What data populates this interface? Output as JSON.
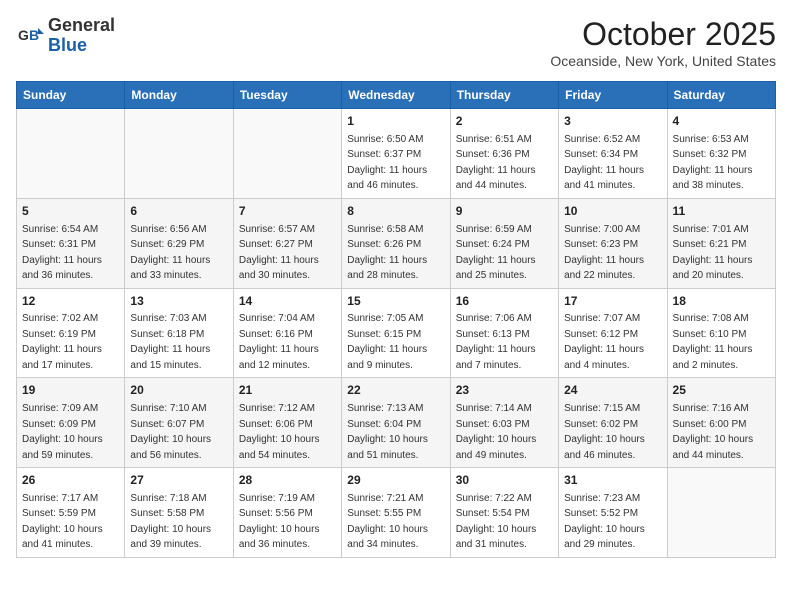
{
  "header": {
    "logo_general": "General",
    "logo_blue": "Blue",
    "title": "October 2025",
    "subtitle": "Oceanside, New York, United States"
  },
  "columns": [
    "Sunday",
    "Monday",
    "Tuesday",
    "Wednesday",
    "Thursday",
    "Friday",
    "Saturday"
  ],
  "weeks": [
    [
      {
        "day": "",
        "sunrise": "",
        "sunset": "",
        "daylight": ""
      },
      {
        "day": "",
        "sunrise": "",
        "sunset": "",
        "daylight": ""
      },
      {
        "day": "",
        "sunrise": "",
        "sunset": "",
        "daylight": ""
      },
      {
        "day": "1",
        "sunrise": "Sunrise: 6:50 AM",
        "sunset": "Sunset: 6:37 PM",
        "daylight": "Daylight: 11 hours and 46 minutes."
      },
      {
        "day": "2",
        "sunrise": "Sunrise: 6:51 AM",
        "sunset": "Sunset: 6:36 PM",
        "daylight": "Daylight: 11 hours and 44 minutes."
      },
      {
        "day": "3",
        "sunrise": "Sunrise: 6:52 AM",
        "sunset": "Sunset: 6:34 PM",
        "daylight": "Daylight: 11 hours and 41 minutes."
      },
      {
        "day": "4",
        "sunrise": "Sunrise: 6:53 AM",
        "sunset": "Sunset: 6:32 PM",
        "daylight": "Daylight: 11 hours and 38 minutes."
      }
    ],
    [
      {
        "day": "5",
        "sunrise": "Sunrise: 6:54 AM",
        "sunset": "Sunset: 6:31 PM",
        "daylight": "Daylight: 11 hours and 36 minutes."
      },
      {
        "day": "6",
        "sunrise": "Sunrise: 6:56 AM",
        "sunset": "Sunset: 6:29 PM",
        "daylight": "Daylight: 11 hours and 33 minutes."
      },
      {
        "day": "7",
        "sunrise": "Sunrise: 6:57 AM",
        "sunset": "Sunset: 6:27 PM",
        "daylight": "Daylight: 11 hours and 30 minutes."
      },
      {
        "day": "8",
        "sunrise": "Sunrise: 6:58 AM",
        "sunset": "Sunset: 6:26 PM",
        "daylight": "Daylight: 11 hours and 28 minutes."
      },
      {
        "day": "9",
        "sunrise": "Sunrise: 6:59 AM",
        "sunset": "Sunset: 6:24 PM",
        "daylight": "Daylight: 11 hours and 25 minutes."
      },
      {
        "day": "10",
        "sunrise": "Sunrise: 7:00 AM",
        "sunset": "Sunset: 6:23 PM",
        "daylight": "Daylight: 11 hours and 22 minutes."
      },
      {
        "day": "11",
        "sunrise": "Sunrise: 7:01 AM",
        "sunset": "Sunset: 6:21 PM",
        "daylight": "Daylight: 11 hours and 20 minutes."
      }
    ],
    [
      {
        "day": "12",
        "sunrise": "Sunrise: 7:02 AM",
        "sunset": "Sunset: 6:19 PM",
        "daylight": "Daylight: 11 hours and 17 minutes."
      },
      {
        "day": "13",
        "sunrise": "Sunrise: 7:03 AM",
        "sunset": "Sunset: 6:18 PM",
        "daylight": "Daylight: 11 hours and 15 minutes."
      },
      {
        "day": "14",
        "sunrise": "Sunrise: 7:04 AM",
        "sunset": "Sunset: 6:16 PM",
        "daylight": "Daylight: 11 hours and 12 minutes."
      },
      {
        "day": "15",
        "sunrise": "Sunrise: 7:05 AM",
        "sunset": "Sunset: 6:15 PM",
        "daylight": "Daylight: 11 hours and 9 minutes."
      },
      {
        "day": "16",
        "sunrise": "Sunrise: 7:06 AM",
        "sunset": "Sunset: 6:13 PM",
        "daylight": "Daylight: 11 hours and 7 minutes."
      },
      {
        "day": "17",
        "sunrise": "Sunrise: 7:07 AM",
        "sunset": "Sunset: 6:12 PM",
        "daylight": "Daylight: 11 hours and 4 minutes."
      },
      {
        "day": "18",
        "sunrise": "Sunrise: 7:08 AM",
        "sunset": "Sunset: 6:10 PM",
        "daylight": "Daylight: 11 hours and 2 minutes."
      }
    ],
    [
      {
        "day": "19",
        "sunrise": "Sunrise: 7:09 AM",
        "sunset": "Sunset: 6:09 PM",
        "daylight": "Daylight: 10 hours and 59 minutes."
      },
      {
        "day": "20",
        "sunrise": "Sunrise: 7:10 AM",
        "sunset": "Sunset: 6:07 PM",
        "daylight": "Daylight: 10 hours and 56 minutes."
      },
      {
        "day": "21",
        "sunrise": "Sunrise: 7:12 AM",
        "sunset": "Sunset: 6:06 PM",
        "daylight": "Daylight: 10 hours and 54 minutes."
      },
      {
        "day": "22",
        "sunrise": "Sunrise: 7:13 AM",
        "sunset": "Sunset: 6:04 PM",
        "daylight": "Daylight: 10 hours and 51 minutes."
      },
      {
        "day": "23",
        "sunrise": "Sunrise: 7:14 AM",
        "sunset": "Sunset: 6:03 PM",
        "daylight": "Daylight: 10 hours and 49 minutes."
      },
      {
        "day": "24",
        "sunrise": "Sunrise: 7:15 AM",
        "sunset": "Sunset: 6:02 PM",
        "daylight": "Daylight: 10 hours and 46 minutes."
      },
      {
        "day": "25",
        "sunrise": "Sunrise: 7:16 AM",
        "sunset": "Sunset: 6:00 PM",
        "daylight": "Daylight: 10 hours and 44 minutes."
      }
    ],
    [
      {
        "day": "26",
        "sunrise": "Sunrise: 7:17 AM",
        "sunset": "Sunset: 5:59 PM",
        "daylight": "Daylight: 10 hours and 41 minutes."
      },
      {
        "day": "27",
        "sunrise": "Sunrise: 7:18 AM",
        "sunset": "Sunset: 5:58 PM",
        "daylight": "Daylight: 10 hours and 39 minutes."
      },
      {
        "day": "28",
        "sunrise": "Sunrise: 7:19 AM",
        "sunset": "Sunset: 5:56 PM",
        "daylight": "Daylight: 10 hours and 36 minutes."
      },
      {
        "day": "29",
        "sunrise": "Sunrise: 7:21 AM",
        "sunset": "Sunset: 5:55 PM",
        "daylight": "Daylight: 10 hours and 34 minutes."
      },
      {
        "day": "30",
        "sunrise": "Sunrise: 7:22 AM",
        "sunset": "Sunset: 5:54 PM",
        "daylight": "Daylight: 10 hours and 31 minutes."
      },
      {
        "day": "31",
        "sunrise": "Sunrise: 7:23 AM",
        "sunset": "Sunset: 5:52 PM",
        "daylight": "Daylight: 10 hours and 29 minutes."
      },
      {
        "day": "",
        "sunrise": "",
        "sunset": "",
        "daylight": ""
      }
    ]
  ]
}
